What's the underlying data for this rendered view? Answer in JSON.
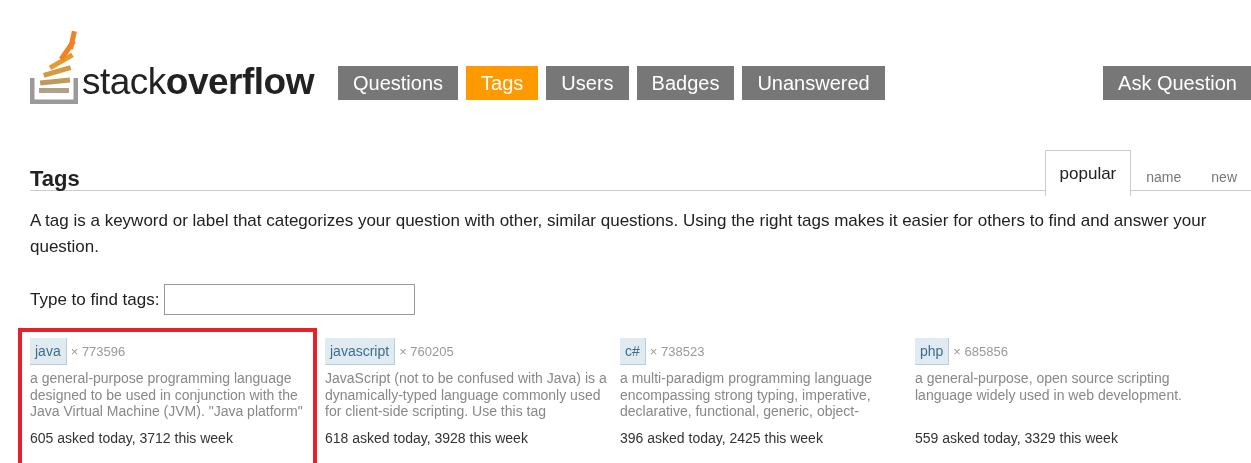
{
  "logo": {
    "text": "stack**overflow**"
  },
  "nav": [
    {
      "label": "Questions",
      "selected": false
    },
    {
      "label": "Tags",
      "selected": true
    },
    {
      "label": "Users",
      "selected": false
    },
    {
      "label": "Badges",
      "selected": false
    },
    {
      "label": "Unanswered",
      "selected": false
    }
  ],
  "ask_button": "Ask Question",
  "heading": "Tags",
  "sort_tabs": [
    {
      "label": "popular",
      "selected": true
    },
    {
      "label": "name",
      "selected": false
    },
    {
      "label": "new",
      "selected": false
    }
  ],
  "intro": "A tag is a keyword or label that categorizes your question with other, similar questions. Using the right tags makes it easier for others to find and answer your question.",
  "filter": {
    "label": "Type to find tags:"
  },
  "tags": [
    {
      "name": "java",
      "count": "× 773596",
      "description": "a general-purpose programming language designed to be used in conjunction with the Java Virtual Machine (JVM). \"Java platform\"",
      "stats": "605 asked today, 3712 this week",
      "highlighted": true
    },
    {
      "name": "javascript",
      "count": "× 760205",
      "description": "JavaScript (not to be confused with Java) is a dynamically-typed language commonly used for client-side scripting. Use this tag",
      "stats": "618 asked today, 3928 this week",
      "highlighted": false
    },
    {
      "name": "c#",
      "count": "× 738523",
      "description": "a multi-paradigm programming language encompassing strong typing, imperative, declarative, functional, generic, object-",
      "stats": "396 asked today, 2425 this week",
      "highlighted": false
    },
    {
      "name": "php",
      "count": "× 685856",
      "description": "a general-purpose, open source scripting language widely used in web development.",
      "stats": "559 asked today, 3329 this week",
      "highlighted": false
    }
  ]
}
